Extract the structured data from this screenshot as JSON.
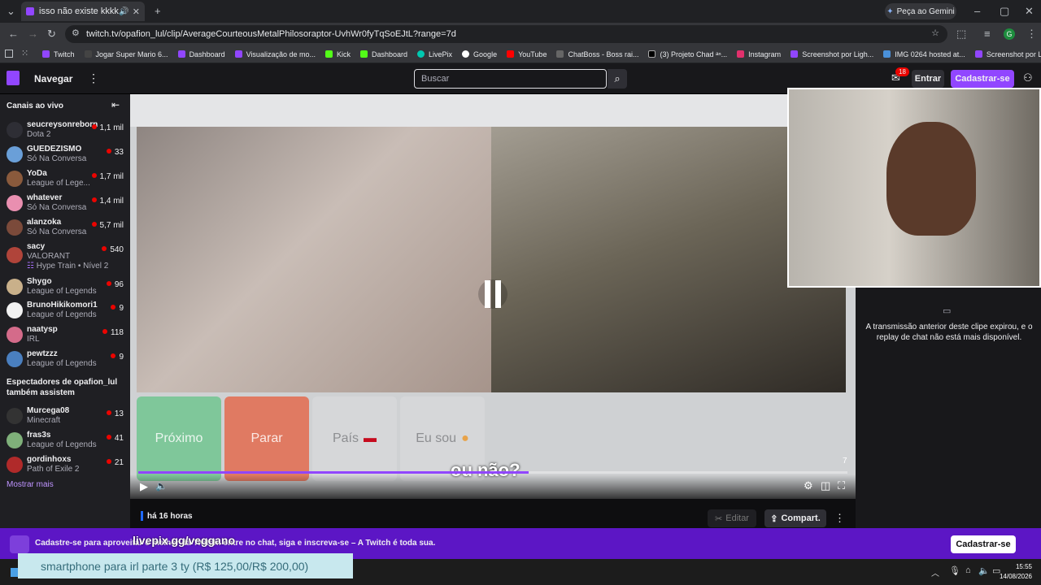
{
  "browser": {
    "tab_title": "isso não existe kkkkkkkkkk",
    "url": "twitch.tv/opafion_lul/clip/AverageCourteousMetalPhilosoraptor-UvhWr0fyTqSoEJtL?range=7d",
    "gemini_label": "Peça ao Gemini",
    "bookmarks": [
      "Twitch",
      "Jogar Super Mario 6...",
      "Dashboard",
      "Visualização de mo...",
      "Kick",
      "Dashboard",
      "LivePix",
      "Google",
      "YouTube",
      "ChatBoss - Boss rai...",
      "(3) Projeto Chad ᵃⁿ...",
      "Instagram",
      "Screenshot por Ligh...",
      "IMG 0264 hosted at...",
      "Screenshot por Ligh..."
    ]
  },
  "topnav": {
    "browse_label": "Navegar",
    "search_placeholder": "Buscar",
    "notif_count": "18",
    "login_label": "Entrar",
    "signup_label": "Cadastrar-se"
  },
  "sidebar": {
    "header": "Canais ao vivo",
    "channels": [
      {
        "name": "seucreysonreborn",
        "game": "Dota 2",
        "viewers": "1,1 mil",
        "color": "#2e2e35"
      },
      {
        "name": "GUEDEZISMO",
        "game": "Só Na Conversa",
        "viewers": "33",
        "color": "#6a9fd8"
      },
      {
        "name": "YoDa",
        "game": "League of Lege...",
        "viewers": "1,7 mil",
        "color": "#8a5a3c"
      },
      {
        "name": "whatever",
        "game": "Só Na Conversa",
        "viewers": "1,4 mil",
        "color": "#e98fb0"
      },
      {
        "name": "alanzoka",
        "game": "Só Na Conversa",
        "viewers": "5,7 mil",
        "color": "#7b4a3a"
      },
      {
        "name": "sacy",
        "game": "VALORANT",
        "extra": "Hype Train • Nível 2",
        "viewers": "540",
        "color": "#b0443a"
      },
      {
        "name": "Shygo",
        "game": "League of Legends",
        "viewers": "96",
        "color": "#c9b08a"
      },
      {
        "name": "BrunoHikikomori1",
        "game": "League of Legends",
        "viewers": "9",
        "color": "#f2f2f2"
      },
      {
        "name": "naatysp",
        "game": "IRL",
        "viewers": "118",
        "color": "#d46b8a"
      },
      {
        "name": "pewtzzz",
        "game": "League of Legends",
        "viewers": "9",
        "color": "#4a7fbf"
      }
    ],
    "also_watch_header": "Espectadores de opafion_lul também assistem",
    "also_watch": [
      {
        "name": "Murcega08",
        "game": "Minecraft",
        "viewers": "13",
        "color": "#333"
      },
      {
        "name": "fras3s",
        "game": "League of Legends",
        "viewers": "41",
        "color": "#7fb07a"
      },
      {
        "name": "gordinhoxs",
        "game": "Path of Exile 2",
        "viewers": "21",
        "color": "#b02a2a"
      }
    ],
    "show_more": "Mostrar mais"
  },
  "video": {
    "buttons": {
      "next": "Próximo",
      "stop": "Parar",
      "country": "País",
      "iam": "Eu sou"
    },
    "caption": "ou não?",
    "counter": "7",
    "progress": 0.55
  },
  "clip_info": {
    "time_ago": "há 16 horas",
    "clip_label": "Editar",
    "share_label": "Compart."
  },
  "chat": {
    "expired_msg": "A transmissão anterior deste clipe expirou, e o replay de chat não está mais disponível."
  },
  "banner": {
    "text": "Cadastre-se para aproveitar o melhor da Twitch: entre no chat, siga e inscreva-se – A Twitch é toda sua.",
    "button": "Cadastrar-se",
    "livepix": "livepix.gg/veggano"
  },
  "overlay": {
    "text": "smartphone para irl parte 3 ty (R$ 125,00/R$ 200,00)"
  },
  "taskbar": {
    "time": "15:55",
    "date": "14/08/2026"
  }
}
